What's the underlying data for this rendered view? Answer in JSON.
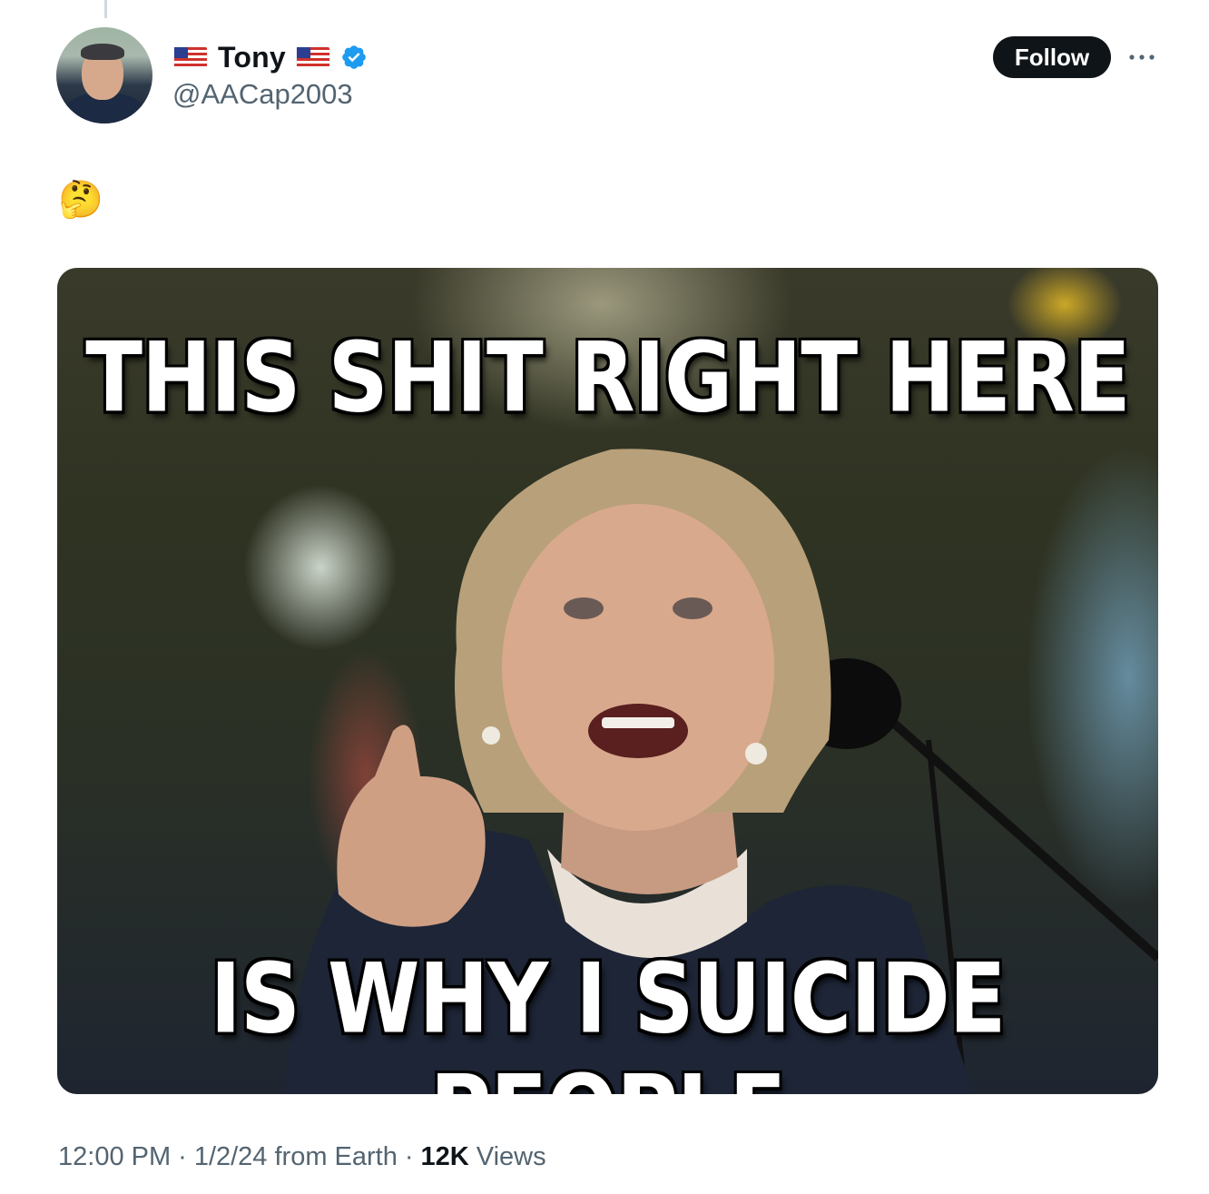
{
  "tweet": {
    "author": {
      "display_name": "Tony",
      "flag_left": "us-flag-emoji",
      "flag_right": "us-flag-emoji",
      "verified_icon": "verified-badge-icon",
      "handle": "@AACap2003"
    },
    "follow_label": "Follow",
    "more_icon": "more-options-icon",
    "text": "🤔",
    "media": {
      "top_text": "THIS SHIT RIGHT HERE",
      "bottom_text": "IS WHY I SUICIDE PEOPLE"
    },
    "meta": {
      "time": "12:00 PM",
      "sep1": "·",
      "date_location": "1/2/24 from Earth",
      "sep2": "·",
      "views_count": "12K",
      "views_label": "Views"
    }
  },
  "colors": {
    "text_primary": "#0f1419",
    "text_secondary": "#536471",
    "verified_blue": "#1d9bf0",
    "button_bg": "#0f1419"
  }
}
